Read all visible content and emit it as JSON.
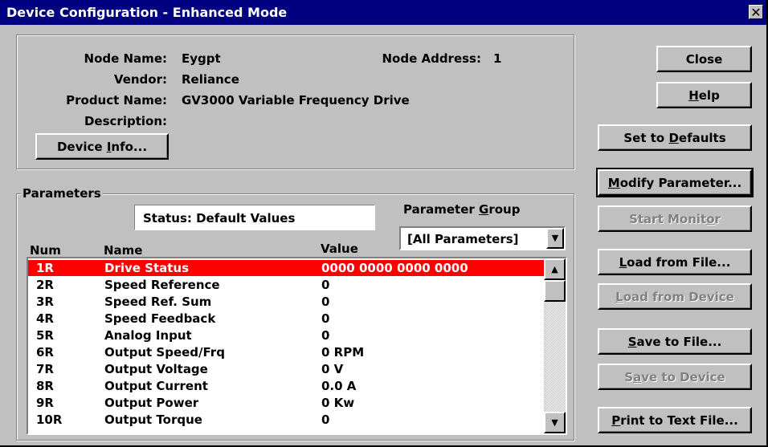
{
  "window": {
    "title": "Device Configuration - Enhanced Mode",
    "close_glyph": "✕"
  },
  "device": {
    "node_name_label": "Node Name:",
    "node_name": "Eygpt",
    "node_address_label": "Node Address:",
    "node_address": "1",
    "vendor_label": "Vendor:",
    "vendor": "Reliance",
    "product_name_label": "Product Name:",
    "product_name": "GV3000 Variable Frequency Drive",
    "description_label": "Description:",
    "description": "",
    "device_info_button": {
      "pre": "Device ",
      "u": "I",
      "post": "nfo..."
    }
  },
  "parameters": {
    "group_label": "Parameters",
    "status_text": "Status: Default Values",
    "param_group_label": {
      "pre": "Parameter ",
      "u": "G",
      "post": "roup"
    },
    "param_group_value": "[All Parameters]",
    "headers": {
      "num": "Num",
      "name": "Name",
      "value": "Value"
    },
    "rows": [
      {
        "num": "1R",
        "name": "Drive Status",
        "value": "0000 0000 0000 0000"
      },
      {
        "num": "2R",
        "name": "Speed Reference",
        "value": "0"
      },
      {
        "num": "3R",
        "name": "Speed Ref. Sum",
        "value": "0"
      },
      {
        "num": "4R",
        "name": "Speed Feedback",
        "value": "0"
      },
      {
        "num": "5R",
        "name": "Analog Input",
        "value": "0"
      },
      {
        "num": "6R",
        "name": "Output Speed/Frq",
        "value": "0 RPM"
      },
      {
        "num": "7R",
        "name": "Output Voltage",
        "value": "0 V"
      },
      {
        "num": "8R",
        "name": "Output Current",
        "value": "0.0 A"
      },
      {
        "num": "9R",
        "name": "Output Power",
        "value": "0 Kw"
      },
      {
        "num": "10R",
        "name": "Output Torque",
        "value": "0"
      }
    ]
  },
  "buttons": {
    "close": {
      "pre": "Close",
      "u": "",
      "post": ""
    },
    "help": {
      "pre": "",
      "u": "H",
      "post": "elp"
    },
    "set_defaults": {
      "pre": "Set to ",
      "u": "D",
      "post": "efaults"
    },
    "modify": {
      "pre": "",
      "u": "M",
      "post": "odify Parameter..."
    },
    "start_monitor": {
      "pre": "Start Monit",
      "u": "o",
      "post": "r"
    },
    "load_file": {
      "pre": "",
      "u": "L",
      "post": "oad from File..."
    },
    "load_device": {
      "pre": "",
      "u": "L",
      "post": "oad from Device"
    },
    "save_file": {
      "pre": "",
      "u": "S",
      "post": "ave to File..."
    },
    "save_device": {
      "pre": "S",
      "u": "a",
      "post": "ve to Device"
    },
    "print": {
      "pre": "",
      "u": "P",
      "post": "rint to Text File..."
    }
  },
  "colors": {
    "title_bg": "#000080",
    "selection": "#ff0000",
    "face": "#c0c0c0"
  }
}
